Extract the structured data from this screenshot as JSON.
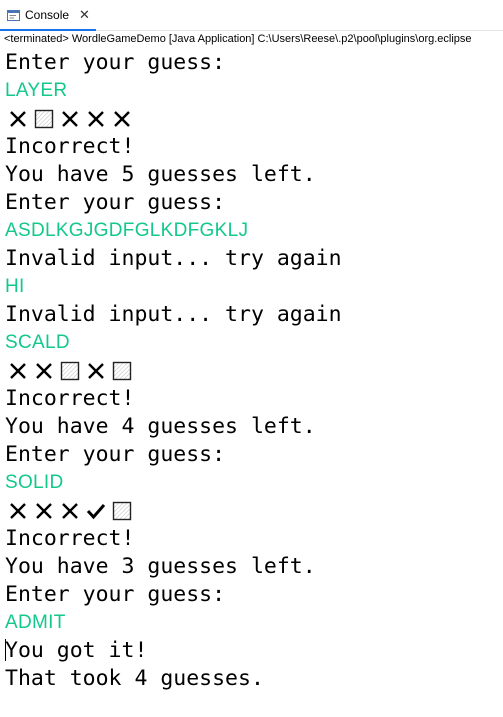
{
  "tab": {
    "label": "Console",
    "close": "✕"
  },
  "status": "<terminated> WordleGameDemo [Java Application] C:\\Users\\Reese\\.p2\\pool\\plugins\\org.eclipse",
  "lines": [
    {
      "kind": "text",
      "text": "Enter your guess:"
    },
    {
      "kind": "input",
      "text": "LAYER"
    },
    {
      "kind": "symbols",
      "symbols": [
        "x",
        "box",
        "x",
        "x",
        "x"
      ]
    },
    {
      "kind": "text",
      "text": "Incorrect!"
    },
    {
      "kind": "text",
      "text": "You have 5 guesses left."
    },
    {
      "kind": "text",
      "text": "Enter your guess:"
    },
    {
      "kind": "input",
      "text": "ASDLKGJGDFGLKDFGKLJ"
    },
    {
      "kind": "text",
      "text": "Invalid input... try again"
    },
    {
      "kind": "input",
      "text": "HI"
    },
    {
      "kind": "text",
      "text": "Invalid input... try again"
    },
    {
      "kind": "input",
      "text": "SCALD"
    },
    {
      "kind": "symbols",
      "symbols": [
        "x",
        "x",
        "box",
        "x",
        "box"
      ]
    },
    {
      "kind": "text",
      "text": "Incorrect!"
    },
    {
      "kind": "text",
      "text": "You have 4 guesses left."
    },
    {
      "kind": "text",
      "text": "Enter your guess:"
    },
    {
      "kind": "input",
      "text": "SOLID"
    },
    {
      "kind": "symbols",
      "symbols": [
        "x",
        "x",
        "x",
        "check",
        "box"
      ]
    },
    {
      "kind": "text",
      "text": "Incorrect!"
    },
    {
      "kind": "text",
      "text": "You have 3 guesses left."
    },
    {
      "kind": "text",
      "text": "Enter your guess:"
    },
    {
      "kind": "input",
      "text": "ADMIT"
    },
    {
      "kind": "text",
      "text": "You got it!",
      "caret": true
    },
    {
      "kind": "text",
      "text": "That took 4 guesses."
    }
  ],
  "colors": {
    "input": "#12c98a",
    "tab_accent": "#1a73e8"
  }
}
